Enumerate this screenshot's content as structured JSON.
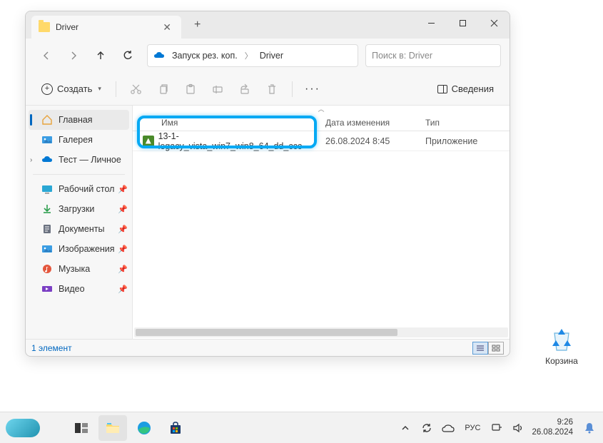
{
  "window": {
    "tab_title": "Driver",
    "breadcrumb": {
      "root": "Запуск рез. коп.",
      "current": "Driver"
    },
    "search_placeholder": "Поиск в: Driver",
    "create_label": "Создать",
    "details_label": "Сведения"
  },
  "sidebar": {
    "home": "Главная",
    "gallery": "Галерея",
    "personal": "Тест — Личное",
    "desktop": "Рабочий стол",
    "downloads": "Загрузки",
    "documents": "Документы",
    "pictures": "Изображения",
    "music": "Музыка",
    "videos": "Видео"
  },
  "columns": {
    "name": "Имя",
    "date": "Дата изменения",
    "type": "Тип"
  },
  "files": [
    {
      "name": "13-1-legacy_vista_win7_win8_64_dd_ccc",
      "date": "26.08.2024 8:45",
      "type": "Приложение"
    }
  ],
  "status": {
    "count": "1 элемент"
  },
  "desktop": {
    "recycle": "Корзина"
  },
  "taskbar": {
    "lang": "РУС",
    "time": "9:26",
    "date": "26.08.2024"
  }
}
